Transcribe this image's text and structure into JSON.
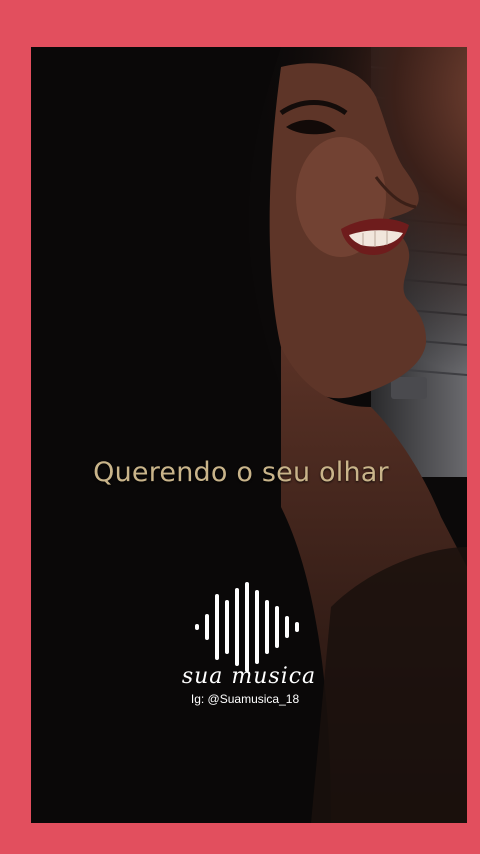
{
  "video": {
    "lyric": "Querendo o seu olhar"
  },
  "logo": {
    "brand_name": "sua musica",
    "instagram_handle": "Ig:  @Suamusica_18"
  },
  "colors": {
    "border": "#e24f5e",
    "lyric": "#c9b48a",
    "logo": "#ffffff"
  },
  "icons": {
    "logo": "sound-wave-icon"
  }
}
